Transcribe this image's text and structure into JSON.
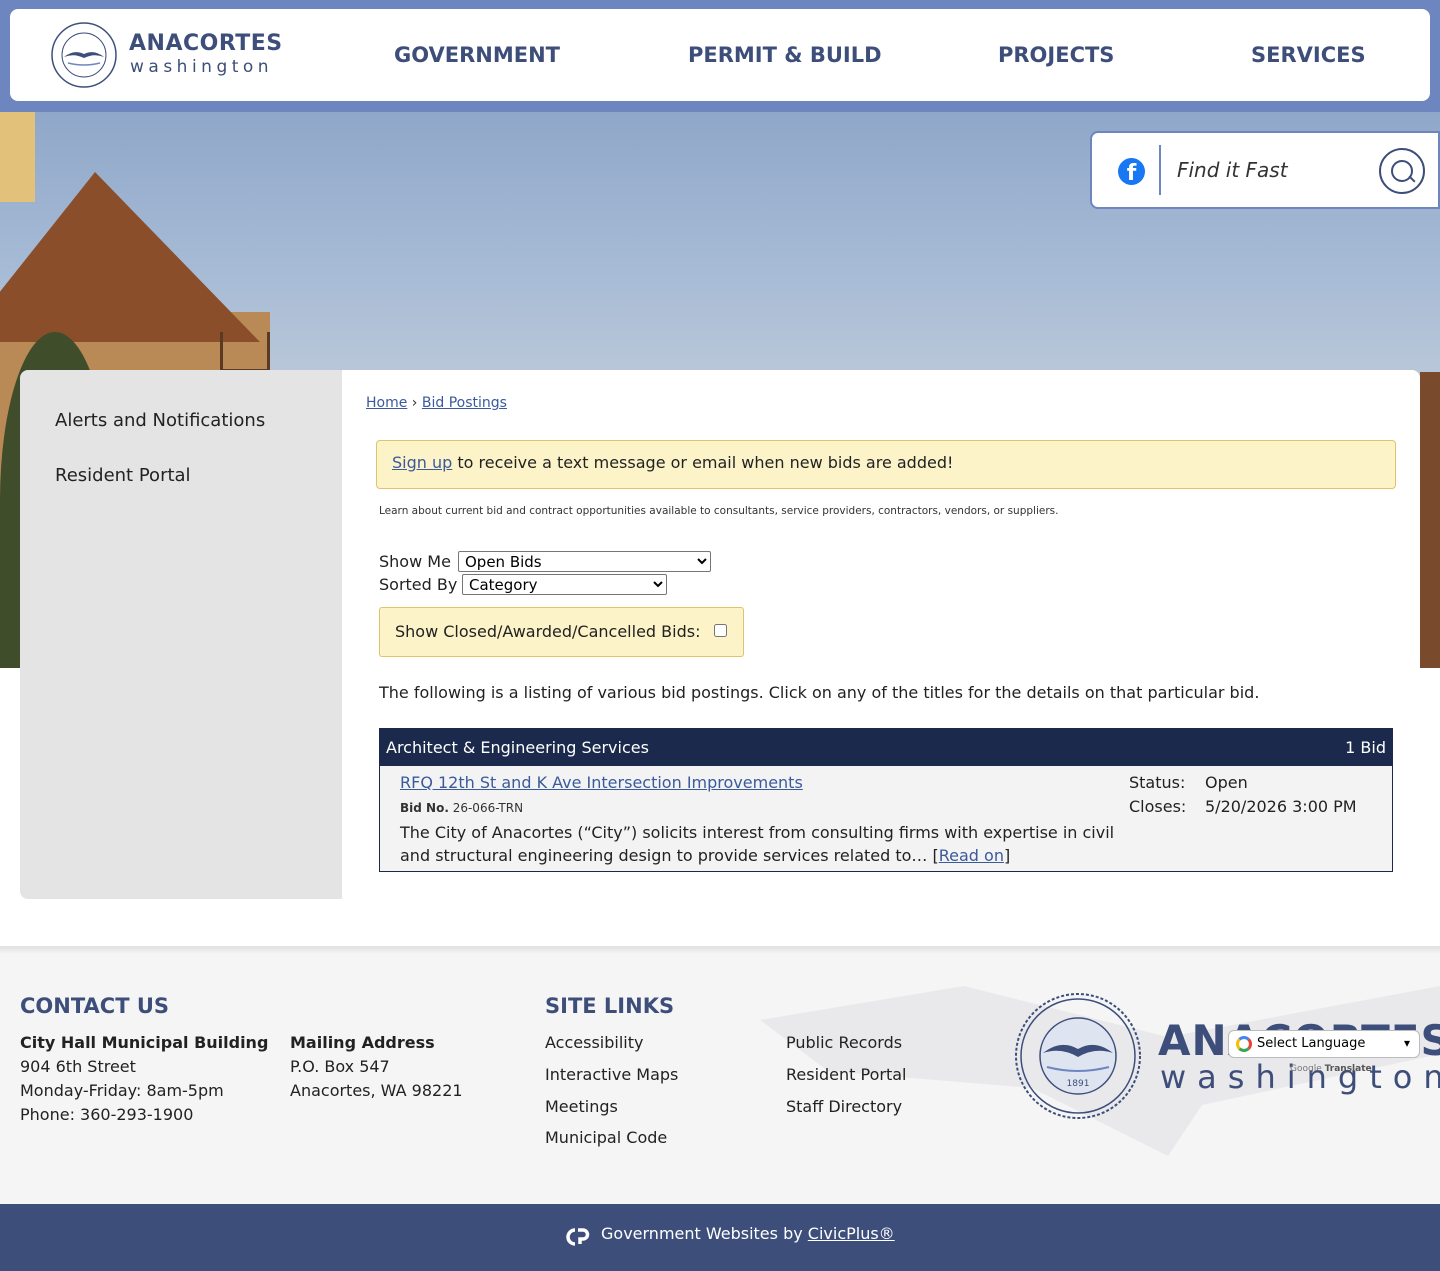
{
  "header": {
    "logo_title": "ANACORTES",
    "logo_subtitle": "washington",
    "nav": [
      "GOVERNMENT",
      "PERMIT & BUILD",
      "PROJECTS",
      "SERVICES"
    ]
  },
  "search": {
    "placeholder": "Find it Fast"
  },
  "sidebar": {
    "items": [
      {
        "label": "Alerts and Notifications"
      },
      {
        "label": "Resident Portal"
      }
    ]
  },
  "breadcrumb": {
    "home": "Home",
    "separator": "›",
    "current": "Bid Postings"
  },
  "signup_banner": {
    "link": "Sign up",
    "text": " to receive a text message or email when new bids are added!"
  },
  "intro": "Learn about current bid and contract opportunities available to consultants, service providers, contractors, vendors, or suppliers.",
  "filters": {
    "show_me_label": "Show Me",
    "show_me_value": "Open Bids",
    "sorted_by_label": "Sorted By",
    "sorted_by_value": "Category",
    "closed_label": "Show Closed/Awarded/Cancelled Bids:"
  },
  "listing_intro": "The following is a listing of various bid postings. Click on any of the titles for the details on that particular bid.",
  "bid_category": {
    "name": "Architect & Engineering Services",
    "count": "1 Bid",
    "bids": [
      {
        "title": "RFQ 12th St and K Ave Intersection Improvements",
        "bid_no_label": "Bid No.",
        "bid_no": "26-066-TRN",
        "description": "The City of Anacortes (“City”) solicits interest from consulting firms with expertise in civil and structural engineering design to provide services related to…",
        "read_on_open": " [",
        "read_on": "Read on",
        "read_on_close": "]",
        "status_label": "Status:",
        "status": "Open",
        "closes_label": "Closes:",
        "closes": "5/20/2026 3:00 PM"
      }
    ]
  },
  "footer": {
    "contact_heading": "CONTACT US",
    "city_hall": {
      "name": "City Hall Municipal Building",
      "street": "904 6th Street",
      "hours": "Monday-Friday: 8am-5pm",
      "phone": "Phone: 360-293-1900"
    },
    "mailing": {
      "name": "Mailing Address",
      "box": "P.O. Box 547",
      "city": "Anacortes, WA 98221"
    },
    "site_links_heading": "SITE LINKS",
    "links_col1": [
      "Accessibility",
      "Interactive Maps",
      "Meetings",
      "Municipal Code"
    ],
    "links_col2": [
      "Public Records",
      "Resident Portal",
      "Staff Directory"
    ],
    "logo_title": "ANACORTES",
    "logo_subtitle": "washington",
    "seal_year": "1891",
    "translate_label": "Select Language",
    "powered_by_prefix": "Google",
    "powered_by": "Translate"
  },
  "bottom_bar": {
    "text": "Government Websites by ",
    "link": "CivicPlus®"
  },
  "colors": {
    "brand_blue": "#3d4e7a",
    "header_band": "#6d86c0",
    "bid_header": "#1b2a4c",
    "notice_bg": "#fcf3c9"
  }
}
